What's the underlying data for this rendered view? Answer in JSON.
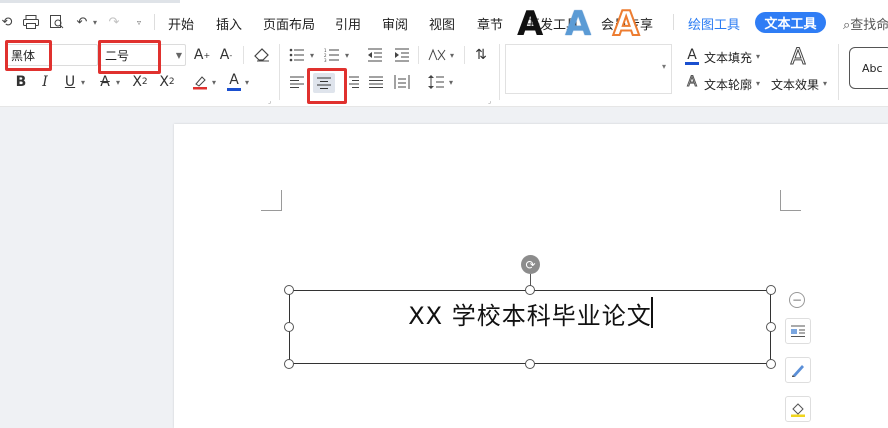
{
  "menu": {
    "items": [
      "开始",
      "插入",
      "页面布局",
      "引用",
      "审阅",
      "视图",
      "章节",
      "开发工具",
      "会员专享"
    ],
    "context_tab": "绘图工具",
    "active_tab": "文本工具",
    "search_label": "查找命"
  },
  "ribbon": {
    "font_name": "黑体",
    "font_size": "二号",
    "text_fill_label": "文本填充",
    "text_outline_label": "文本轮廓",
    "text_effect_label": "文本效果",
    "style_preview_label": "Abc",
    "style_gallery_letter": "A"
  },
  "document": {
    "textbox_text": "XX 学校本科毕业论文"
  },
  "colors": {
    "accent": "#2f7df5",
    "highlight": "#e0312e",
    "font_color_bar": "#e0312e",
    "fill_color_bar": "#1a4fcf"
  }
}
